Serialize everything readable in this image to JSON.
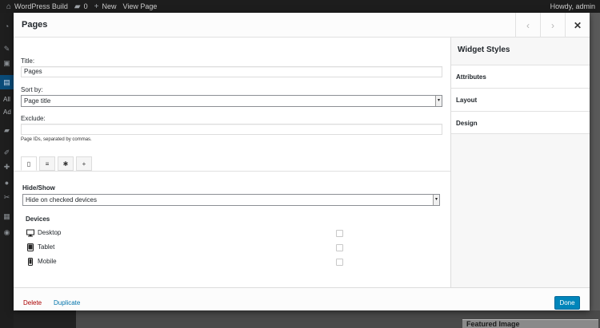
{
  "adminbar": {
    "site_name": "WordPress Build",
    "comments_count": "0",
    "new_label": "New",
    "view_label": "View Page",
    "howdy": "Howdy, admin"
  },
  "wp_sidebar": {
    "sub_all": "All",
    "sub_add": "Ad"
  },
  "modal": {
    "title": "Pages",
    "fields": {
      "title_label": "Title:",
      "title_value": "Pages",
      "sort_label": "Sort by:",
      "sort_value": "Page title",
      "exclude_label": "Exclude:",
      "exclude_value": "",
      "exclude_hint": "Page IDs, separated by commas."
    },
    "tabs": [
      {
        "icon": "mobile-icon",
        "glyph": "▯"
      },
      {
        "icon": "align-icon",
        "glyph": "≡"
      },
      {
        "icon": "gear-icon",
        "glyph": "✱"
      },
      {
        "icon": "plus-icon",
        "glyph": "+"
      }
    ],
    "hide_show": {
      "label": "Hide/Show",
      "value": "Hide on checked devices"
    },
    "devices": {
      "title": "Devices",
      "items": [
        {
          "label": "Desktop",
          "icon": "desktop-icon",
          "checked": false
        },
        {
          "label": "Tablet",
          "icon": "tablet-icon",
          "checked": false
        },
        {
          "label": "Mobile",
          "icon": "mobile-icon",
          "checked": false
        }
      ]
    },
    "side": {
      "title": "Widget Styles",
      "items": [
        "Attributes",
        "Layout",
        "Design"
      ]
    },
    "footer": {
      "delete": "Delete",
      "duplicate": "Duplicate",
      "done": "Done"
    }
  },
  "background": {
    "featured_image": "Featured Image"
  },
  "colors": {
    "accent": "#0085ba",
    "delete": "#aa0000",
    "link": "#0073aa"
  }
}
